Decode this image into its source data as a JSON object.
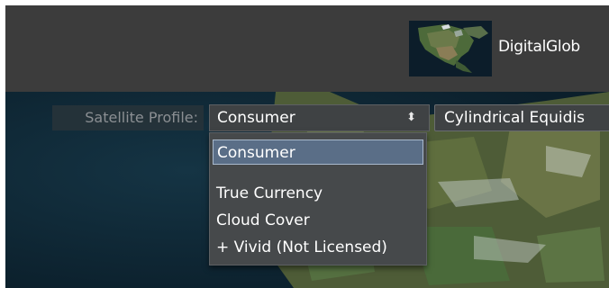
{
  "provider": {
    "name": "DigitalGlob",
    "thumbnail_icon": "north-america-satellite-thumbnail"
  },
  "profile": {
    "label": "Satellite Profile:",
    "selected_value": "Consumer",
    "arrow_glyph": "⬍",
    "options": [
      "Consumer",
      "True Currency",
      "Cloud Cover",
      "+ Vivid (Not Licensed)"
    ]
  },
  "projection": {
    "selected_value": "Cylindrical Equidis"
  },
  "colors": {
    "toolbar_bg": "#3c3c3c",
    "control_bg": "#3f4244",
    "highlight": "#5a6e87"
  }
}
